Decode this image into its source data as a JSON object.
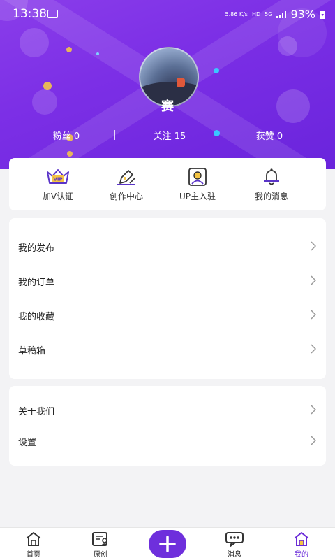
{
  "status_bar": {
    "time": "13:38",
    "network_speed": "5.86 K/s",
    "hd": "HD",
    "signal": "5G",
    "battery": "93%"
  },
  "profile": {
    "username": "赛",
    "stats": [
      {
        "label": "粉丝 0"
      },
      {
        "label": "关注 15"
      },
      {
        "label": "获赞 0"
      }
    ]
  },
  "quick_actions": [
    {
      "label": "加V认证",
      "icon": "vip-crown-icon"
    },
    {
      "label": "创作中心",
      "icon": "pen-icon"
    },
    {
      "label": "UP主入驻",
      "icon": "up-portrait-icon"
    },
    {
      "label": "我的消息",
      "icon": "bell-icon"
    }
  ],
  "menu_group1": [
    {
      "label": "我的发布"
    },
    {
      "label": "我的订单"
    },
    {
      "label": "我的收藏"
    },
    {
      "label": "草稿箱"
    }
  ],
  "menu_group2": [
    {
      "label": "关于我们"
    },
    {
      "label": "设置"
    }
  ],
  "tabbar": {
    "items": [
      {
        "label": "首页",
        "icon": "home-icon"
      },
      {
        "label": "原创",
        "icon": "original-icon"
      },
      {
        "label": "",
        "icon": "plus-icon"
      },
      {
        "label": "消息",
        "icon": "message-icon"
      },
      {
        "label": "我的",
        "icon": "home-icon"
      }
    ],
    "active": "我的"
  },
  "colors": {
    "accent": "#6e2fdc",
    "header": "#7c2fe6"
  }
}
